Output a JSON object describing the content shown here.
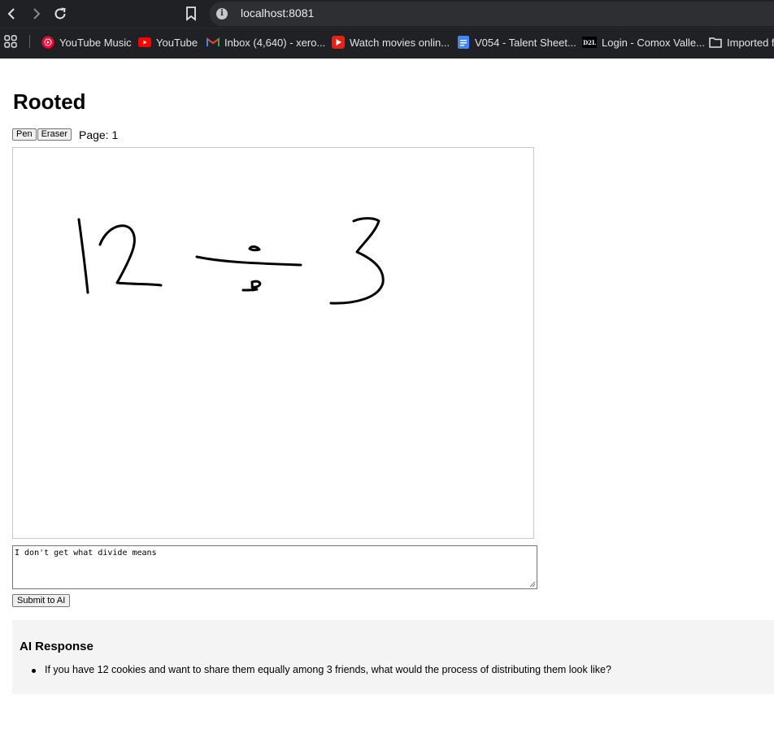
{
  "browser": {
    "url": "localhost:8081",
    "bookmarks": [
      {
        "label": "YouTube Music",
        "icon": "youtube-music-icon",
        "color": "#ff0033"
      },
      {
        "label": "YouTube",
        "icon": "youtube-icon",
        "color": "#ff0000"
      },
      {
        "label": "Inbox (4,640) - xero...",
        "icon": "gmail-icon",
        "color": "#ea4335"
      },
      {
        "label": "Watch movies onlin...",
        "icon": "play-icon",
        "color": "#e62117"
      },
      {
        "label": "V054 - Talent Sheet...",
        "icon": "docs-icon",
        "color": "#4285f4"
      },
      {
        "label": "Login - Comox Valle...",
        "icon": "d2l-icon",
        "color": "#000000"
      },
      {
        "label": "Imported f",
        "icon": "folder-icon",
        "color": "#e3e3e3"
      }
    ]
  },
  "app": {
    "title": "Rooted",
    "tools": {
      "pen": "Pen",
      "eraser": "Eraser"
    },
    "page_label": "Page: 1",
    "prompt_value": "I don't get what divide means",
    "submit_label": "Submit to AI"
  },
  "ai_response": {
    "heading": "AI Response",
    "items": [
      "If you have 12 cookies and want to share them equally among 3 friends, what would the process of distributing them look like?"
    ]
  }
}
